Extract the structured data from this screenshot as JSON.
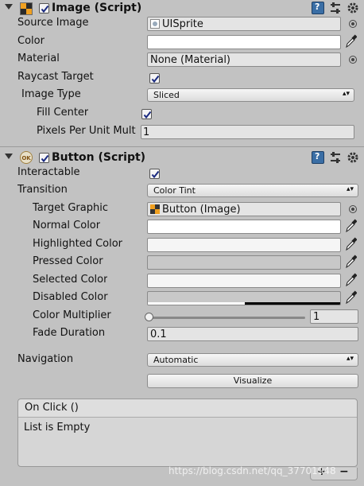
{
  "image_component": {
    "title": "Image (Script)",
    "enabled": true,
    "source_image": {
      "label": "Source Image",
      "value": "UISprite"
    },
    "color": {
      "label": "Color",
      "value": "#FFFFFF"
    },
    "material": {
      "label": "Material",
      "value": "None (Material)"
    },
    "raycast_target": {
      "label": "Raycast Target",
      "checked": true
    },
    "image_type": {
      "label": "Image Type",
      "value": "Sliced"
    },
    "fill_center": {
      "label": "Fill Center",
      "checked": true
    },
    "pixels_per_unit": {
      "label": "Pixels Per Unit Mult",
      "value": "1"
    }
  },
  "button_component": {
    "title": "Button (Script)",
    "enabled": true,
    "interactable": {
      "label": "Interactable",
      "checked": true
    },
    "transition": {
      "label": "Transition",
      "value": "Color Tint"
    },
    "target_graphic": {
      "label": "Target Graphic",
      "value": "Button (Image)"
    },
    "normal_color": {
      "label": "Normal Color",
      "value": "#FFFFFF"
    },
    "highlighted_color": {
      "label": "Highlighted Color",
      "value": "#F5F5F5"
    },
    "pressed_color": {
      "label": "Pressed Color",
      "value": "#C8C8C8"
    },
    "selected_color": {
      "label": "Selected Color",
      "value": "#F5F5F5"
    },
    "disabled_color": {
      "label": "Disabled Color",
      "value": "#C8C8C8",
      "alpha_bar": "#000000"
    },
    "color_multiplier": {
      "label": "Color Multiplier",
      "value": "1",
      "fraction": 0.0
    },
    "fade_duration": {
      "label": "Fade Duration",
      "value": "0.1"
    },
    "navigation": {
      "label": "Navigation",
      "value": "Automatic"
    },
    "visualize_label": "Visualize",
    "on_click": {
      "header": "On Click ()",
      "empty_text": "List is Empty"
    }
  },
  "header_icons": [
    "help-book-icon",
    "preset-sliders-icon",
    "gear-icon"
  ],
  "watermark": "https://blog.csdn.net/qq_37701948"
}
